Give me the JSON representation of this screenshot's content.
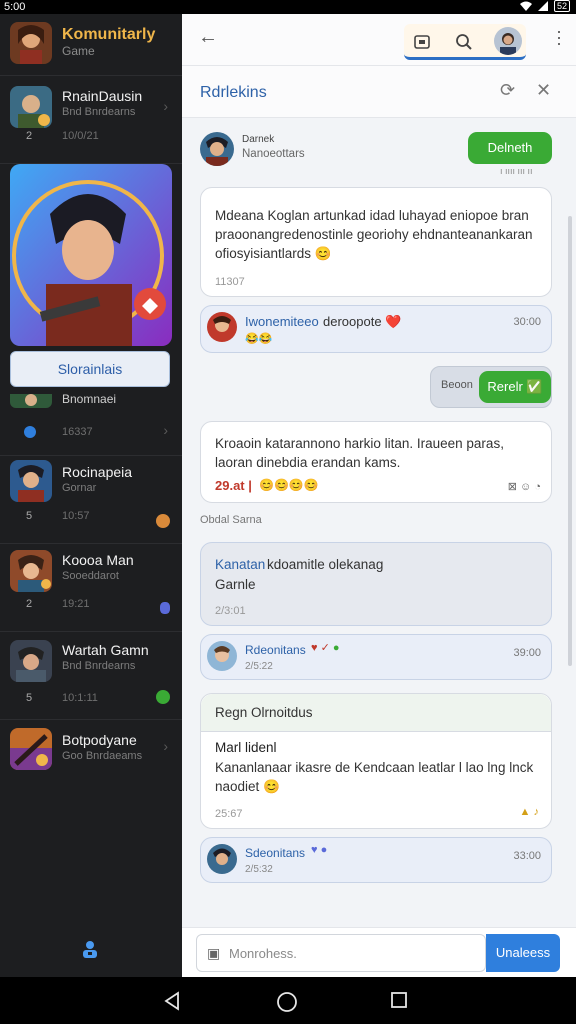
{
  "status": {
    "time": "5:00",
    "battery": "52"
  },
  "sidebar": {
    "header": {
      "title": "Komunitarly",
      "subtitle": "Game"
    },
    "items": [
      {
        "name": "RnainDausin",
        "meta": "Bnd Bnrdearns",
        "num": "2",
        "stamp": "10/0/21"
      },
      {
        "name": "",
        "meta": "Bnomnaei",
        "num": "",
        "stamp": "16337"
      },
      {
        "name": "Rocinapeia",
        "meta": "Gornar",
        "num": "5",
        "stamp": "10:57"
      },
      {
        "name": "Koooa Man",
        "meta": "Sooeddarot",
        "num": "2",
        "stamp": "19:21"
      },
      {
        "name": "Wartah Gamn",
        "meta": "Bnd Bnrdearns",
        "num": "5",
        "stamp": "10:1:11"
      },
      {
        "name": "Botpodyane",
        "meta": "Goo Bnrdaeams",
        "num": "",
        "stamp": ""
      }
    ],
    "feature_button": "Slorainlais"
  },
  "topbar": {
    "back_icon": "arrow-left",
    "icons": [
      "screen-icon",
      "search-icon",
      "avatar"
    ]
  },
  "conversation": {
    "title": "Rdrlekins",
    "messages": [
      {
        "author": "Darnek",
        "handle": "Nanoeottars"
      },
      {
        "text": "Mdeana Koglan artunkad idad luhayad eniopoe bran praoonangredenostinle georiohy ehdnanteanankaran ofiosyisiantlards 😊",
        "time": "11307"
      },
      {
        "author": "Iwonemiteeo",
        "text": "deroopote ❤️",
        "reactions": "😂😂",
        "stamp": "30:00"
      },
      {
        "button_left": "Beoon",
        "button_right": "Rerelr ✅"
      },
      {
        "text": "Kroaoin katarannono harkio litan. Iraueen paras, laoran dinebdia erandan kams.",
        "price": "29.at |",
        "reactions": "😊😊😊😊"
      },
      {
        "section": "Obdal Sarna"
      },
      {
        "title": "Kanatan",
        "subtitle": "kdoamitle olekanag",
        "text": "Garnle",
        "time": "2/3:01"
      },
      {
        "author": "Rdeonitans",
        "stamp": "39:00",
        "time": "2/5:22"
      },
      {
        "header": "Regn Olrnoitdus",
        "name": "Marl lidenl",
        "text": "Kananlanaar ikasre de Kendcaan leatlar l lao lng lnck naodiet 😊",
        "time": "25:67"
      },
      {
        "author": "Sdeonitans",
        "stamp": "33:00",
        "time": "2/5:32"
      }
    ],
    "primary_button": "Delneth"
  },
  "composer": {
    "placeholder": "Monrohess.",
    "send_label": "Unaleess"
  },
  "colors": {
    "accent": "#2f7fdd",
    "green": "#3aaa35",
    "sidebar_bg": "#1d1e20",
    "gold": "#f0b64a"
  }
}
